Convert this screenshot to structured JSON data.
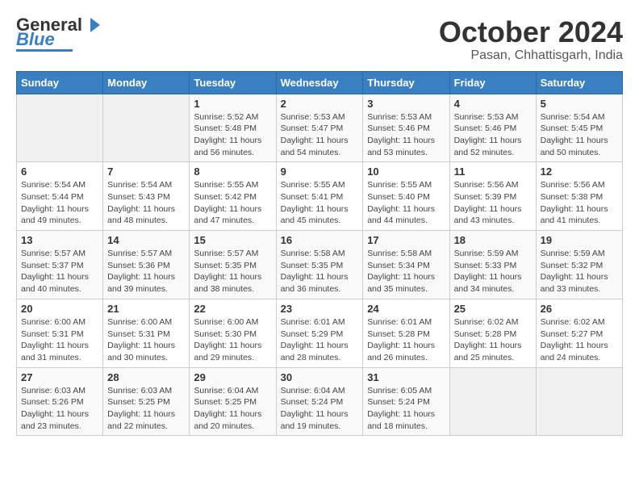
{
  "logo": {
    "line1": "General",
    "line2": "Blue"
  },
  "title": "October 2024",
  "subtitle": "Pasan, Chhattisgarh, India",
  "days_of_week": [
    "Sunday",
    "Monday",
    "Tuesday",
    "Wednesday",
    "Thursday",
    "Friday",
    "Saturday"
  ],
  "weeks": [
    [
      {
        "day": "",
        "text": ""
      },
      {
        "day": "",
        "text": ""
      },
      {
        "day": "1",
        "text": "Sunrise: 5:52 AM\nSunset: 5:48 PM\nDaylight: 11 hours and 56 minutes."
      },
      {
        "day": "2",
        "text": "Sunrise: 5:53 AM\nSunset: 5:47 PM\nDaylight: 11 hours and 54 minutes."
      },
      {
        "day": "3",
        "text": "Sunrise: 5:53 AM\nSunset: 5:46 PM\nDaylight: 11 hours and 53 minutes."
      },
      {
        "day": "4",
        "text": "Sunrise: 5:53 AM\nSunset: 5:46 PM\nDaylight: 11 hours and 52 minutes."
      },
      {
        "day": "5",
        "text": "Sunrise: 5:54 AM\nSunset: 5:45 PM\nDaylight: 11 hours and 50 minutes."
      }
    ],
    [
      {
        "day": "6",
        "text": "Sunrise: 5:54 AM\nSunset: 5:44 PM\nDaylight: 11 hours and 49 minutes."
      },
      {
        "day": "7",
        "text": "Sunrise: 5:54 AM\nSunset: 5:43 PM\nDaylight: 11 hours and 48 minutes."
      },
      {
        "day": "8",
        "text": "Sunrise: 5:55 AM\nSunset: 5:42 PM\nDaylight: 11 hours and 47 minutes."
      },
      {
        "day": "9",
        "text": "Sunrise: 5:55 AM\nSunset: 5:41 PM\nDaylight: 11 hours and 45 minutes."
      },
      {
        "day": "10",
        "text": "Sunrise: 5:55 AM\nSunset: 5:40 PM\nDaylight: 11 hours and 44 minutes."
      },
      {
        "day": "11",
        "text": "Sunrise: 5:56 AM\nSunset: 5:39 PM\nDaylight: 11 hours and 43 minutes."
      },
      {
        "day": "12",
        "text": "Sunrise: 5:56 AM\nSunset: 5:38 PM\nDaylight: 11 hours and 41 minutes."
      }
    ],
    [
      {
        "day": "13",
        "text": "Sunrise: 5:57 AM\nSunset: 5:37 PM\nDaylight: 11 hours and 40 minutes."
      },
      {
        "day": "14",
        "text": "Sunrise: 5:57 AM\nSunset: 5:36 PM\nDaylight: 11 hours and 39 minutes."
      },
      {
        "day": "15",
        "text": "Sunrise: 5:57 AM\nSunset: 5:35 PM\nDaylight: 11 hours and 38 minutes."
      },
      {
        "day": "16",
        "text": "Sunrise: 5:58 AM\nSunset: 5:35 PM\nDaylight: 11 hours and 36 minutes."
      },
      {
        "day": "17",
        "text": "Sunrise: 5:58 AM\nSunset: 5:34 PM\nDaylight: 11 hours and 35 minutes."
      },
      {
        "day": "18",
        "text": "Sunrise: 5:59 AM\nSunset: 5:33 PM\nDaylight: 11 hours and 34 minutes."
      },
      {
        "day": "19",
        "text": "Sunrise: 5:59 AM\nSunset: 5:32 PM\nDaylight: 11 hours and 33 minutes."
      }
    ],
    [
      {
        "day": "20",
        "text": "Sunrise: 6:00 AM\nSunset: 5:31 PM\nDaylight: 11 hours and 31 minutes."
      },
      {
        "day": "21",
        "text": "Sunrise: 6:00 AM\nSunset: 5:31 PM\nDaylight: 11 hours and 30 minutes."
      },
      {
        "day": "22",
        "text": "Sunrise: 6:00 AM\nSunset: 5:30 PM\nDaylight: 11 hours and 29 minutes."
      },
      {
        "day": "23",
        "text": "Sunrise: 6:01 AM\nSunset: 5:29 PM\nDaylight: 11 hours and 28 minutes."
      },
      {
        "day": "24",
        "text": "Sunrise: 6:01 AM\nSunset: 5:28 PM\nDaylight: 11 hours and 26 minutes."
      },
      {
        "day": "25",
        "text": "Sunrise: 6:02 AM\nSunset: 5:28 PM\nDaylight: 11 hours and 25 minutes."
      },
      {
        "day": "26",
        "text": "Sunrise: 6:02 AM\nSunset: 5:27 PM\nDaylight: 11 hours and 24 minutes."
      }
    ],
    [
      {
        "day": "27",
        "text": "Sunrise: 6:03 AM\nSunset: 5:26 PM\nDaylight: 11 hours and 23 minutes."
      },
      {
        "day": "28",
        "text": "Sunrise: 6:03 AM\nSunset: 5:25 PM\nDaylight: 11 hours and 22 minutes."
      },
      {
        "day": "29",
        "text": "Sunrise: 6:04 AM\nSunset: 5:25 PM\nDaylight: 11 hours and 20 minutes."
      },
      {
        "day": "30",
        "text": "Sunrise: 6:04 AM\nSunset: 5:24 PM\nDaylight: 11 hours and 19 minutes."
      },
      {
        "day": "31",
        "text": "Sunrise: 6:05 AM\nSunset: 5:24 PM\nDaylight: 11 hours and 18 minutes."
      },
      {
        "day": "",
        "text": ""
      },
      {
        "day": "",
        "text": ""
      }
    ]
  ]
}
